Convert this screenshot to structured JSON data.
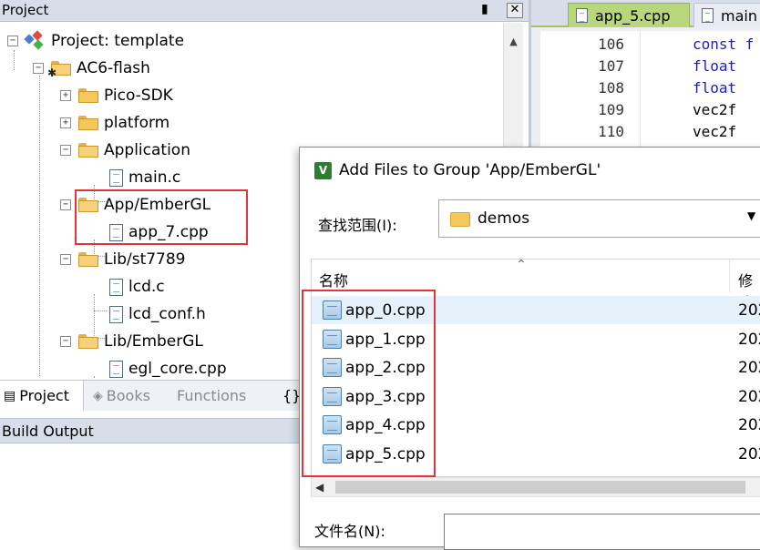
{
  "project_pane": {
    "title": "Project",
    "pin_glyph": "▮",
    "close_glyph": "✕",
    "tree": {
      "root": "Project: template",
      "target": "AC6-flash",
      "items": [
        {
          "label": "Pico-SDK",
          "type": "folder",
          "expanded": false
        },
        {
          "label": "platform",
          "type": "folder",
          "expanded": false
        },
        {
          "label": "Application",
          "type": "folder",
          "expanded": true
        },
        {
          "label": "main.c",
          "type": "file"
        },
        {
          "label": "App/EmberGL",
          "type": "folder",
          "expanded": true
        },
        {
          "label": "app_7.cpp",
          "type": "file"
        },
        {
          "label": "Lib/st7789",
          "type": "folder",
          "expanded": true
        },
        {
          "label": "lcd.c",
          "type": "file"
        },
        {
          "label": "lcd_conf.h",
          "type": "file"
        },
        {
          "label": "Lib/EmberGL",
          "type": "folder",
          "expanded": true
        },
        {
          "label": "egl_core.cpp",
          "type": "file"
        }
      ]
    },
    "bottom_tabs": [
      {
        "label": "Project",
        "icon": "project-tab-icon"
      },
      {
        "label": "Books",
        "icon": "books-icon"
      },
      {
        "label": "Functions",
        "icon": "braces-icon"
      },
      {
        "label": "{}",
        "icon": "templates-icon"
      }
    ]
  },
  "build_output": {
    "title": "Build Output"
  },
  "editor": {
    "tabs": [
      {
        "label": "app_5.cpp",
        "active": true
      },
      {
        "label": "main",
        "active": false
      }
    ],
    "lines": [
      {
        "num": "106",
        "code": "const f",
        "keyword": true
      },
      {
        "num": "107",
        "code": "float",
        "keyword": true
      },
      {
        "num": "108",
        "code": "float",
        "keyword": true
      },
      {
        "num": "109",
        "code": "vec2f",
        "keyword": false
      },
      {
        "num": "110",
        "code": "vec2f",
        "keyword": false
      }
    ]
  },
  "dialog": {
    "title": "Add Files to Group 'App/EmberGL'",
    "app_icon_letter": "V",
    "look_in_label": "查找范围(I):",
    "look_in_value": "demos",
    "columns": {
      "name": "名称",
      "modified": "修改"
    },
    "files": [
      {
        "name": "app_0.cpp",
        "date": "202",
        "selected": true
      },
      {
        "name": "app_1.cpp",
        "date": "202",
        "selected": false
      },
      {
        "name": "app_2.cpp",
        "date": "202",
        "selected": false
      },
      {
        "name": "app_3.cpp",
        "date": "202",
        "selected": false
      },
      {
        "name": "app_4.cpp",
        "date": "202",
        "selected": false
      },
      {
        "name": "app_5.cpp",
        "date": "202",
        "selected": false
      }
    ],
    "file_name_label": "文件名(N):",
    "file_name_value": ""
  },
  "colors": {
    "highlight_box": "#e0353b",
    "active_tab": "#b8d77c",
    "keyword": "#1c1ccc"
  }
}
